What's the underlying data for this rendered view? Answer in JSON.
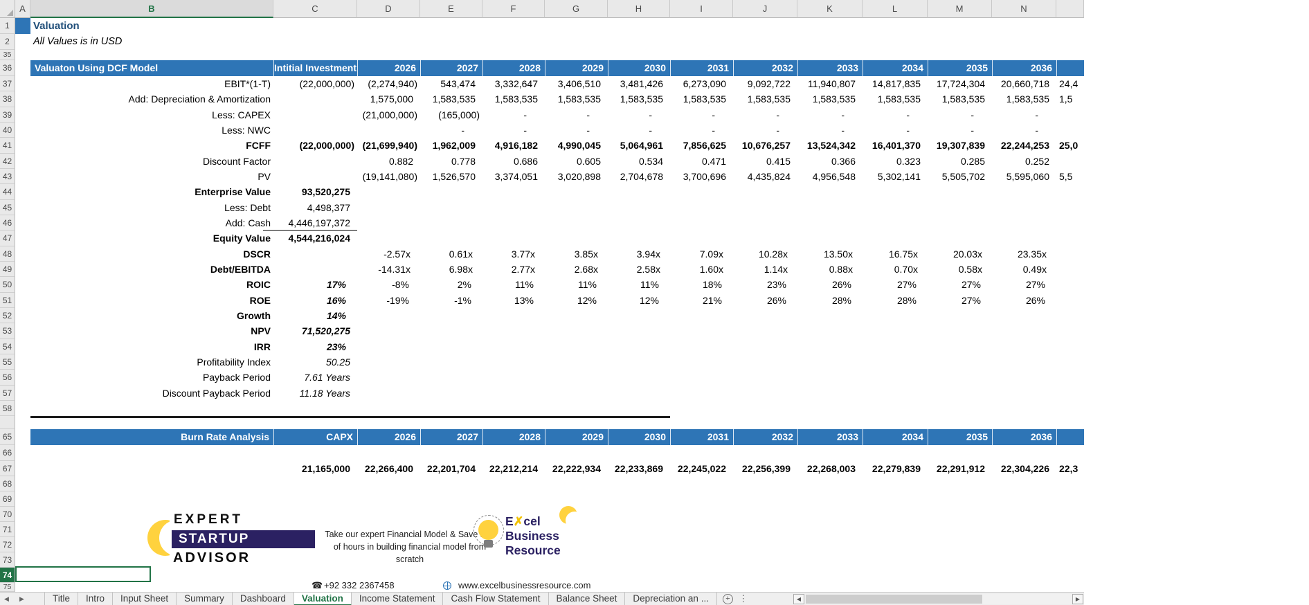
{
  "sheet": {
    "title": "Valuation",
    "subtitle": "All Values is in USD",
    "selected_column": "B",
    "active_row": "74"
  },
  "columns": [
    "A",
    "B",
    "C",
    "D",
    "E",
    "F",
    "G",
    "H",
    "I",
    "J",
    "K",
    "L",
    "M",
    "N"
  ],
  "row_numbers": [
    "1",
    "2",
    "35",
    "36",
    "37",
    "38",
    "39",
    "40",
    "41",
    "42",
    "43",
    "44",
    "45",
    "46",
    "47",
    "48",
    "49",
    "50",
    "51",
    "52",
    "53",
    "54",
    "55",
    "56",
    "57",
    "58",
    "65",
    "66",
    "67",
    "68",
    "69",
    "70",
    "71",
    "72",
    "73",
    "74",
    "75"
  ],
  "dcf": {
    "title": "Valuaton Using DCF Model",
    "investment_header": "Intitial Investment",
    "years": [
      "2026",
      "2027",
      "2028",
      "2029",
      "2030",
      "2031",
      "2032",
      "2033",
      "2034",
      "2035",
      "2036"
    ],
    "rows": [
      {
        "label": "EBIT*(1-T)",
        "c": "(22,000,000)",
        "values": [
          "(2,274,940)",
          "543,474",
          "3,332,647",
          "3,406,510",
          "3,481,426",
          "6,273,090",
          "9,092,722",
          "11,940,807",
          "14,817,835",
          "17,724,304",
          "20,660,718"
        ],
        "o": "24,4"
      },
      {
        "label": "Add: Depreciation & Amortization",
        "c": "",
        "values": [
          "1,575,000",
          "1,583,535",
          "1,583,535",
          "1,583,535",
          "1,583,535",
          "1,583,535",
          "1,583,535",
          "1,583,535",
          "1,583,535",
          "1,583,535",
          "1,583,535"
        ],
        "o": "1,5"
      },
      {
        "label": "Less: CAPEX",
        "c": "",
        "values": [
          "(21,000,000)",
          "(165,000)",
          "-",
          "-",
          "-",
          "-",
          "-",
          "-",
          "-",
          "-",
          "-"
        ],
        "o": ""
      },
      {
        "label": "Less: NWC",
        "c": "",
        "values": [
          "",
          "-",
          "-",
          "-",
          "-",
          "-",
          "-",
          "-",
          "-",
          "-",
          "-"
        ],
        "o": ""
      },
      {
        "label": "FCFF",
        "c": "(22,000,000)",
        "values": [
          "(21,699,940)",
          "1,962,009",
          "4,916,182",
          "4,990,045",
          "5,064,961",
          "7,856,625",
          "10,676,257",
          "13,524,342",
          "16,401,370",
          "19,307,839",
          "22,244,253"
        ],
        "o": "25,0"
      },
      {
        "label": "Discount Factor",
        "c": "",
        "values": [
          "0.882",
          "0.778",
          "0.686",
          "0.605",
          "0.534",
          "0.471",
          "0.415",
          "0.366",
          "0.323",
          "0.285",
          "0.252"
        ],
        "o": ""
      },
      {
        "label": "PV",
        "c": "",
        "values": [
          "(19,141,080)",
          "1,526,570",
          "3,374,051",
          "3,020,898",
          "2,704,678",
          "3,700,696",
          "4,435,824",
          "4,956,548",
          "5,302,141",
          "5,505,702",
          "5,595,060"
        ],
        "o": "5,5"
      },
      {
        "label": "Enterprise Value",
        "c": "93,520,275",
        "values": [],
        "o": ""
      },
      {
        "label": "Less: Debt",
        "c": "4,498,377",
        "values": [],
        "o": ""
      },
      {
        "label": "Add: Cash",
        "c": "4,446,197,372",
        "values": [],
        "o": ""
      },
      {
        "label": "Equity Value",
        "c": "4,544,216,024",
        "values": [],
        "o": ""
      },
      {
        "label": "DSCR",
        "c": "",
        "values": [
          "-2.57x",
          "0.61x",
          "3.77x",
          "3.85x",
          "3.94x",
          "7.09x",
          "10.28x",
          "13.50x",
          "16.75x",
          "20.03x",
          "23.35x"
        ],
        "o": ""
      },
      {
        "label": "Debt/EBITDA",
        "c": "",
        "values": [
          "-14.31x",
          "6.98x",
          "2.77x",
          "2.68x",
          "2.58x",
          "1.60x",
          "1.14x",
          "0.88x",
          "0.70x",
          "0.58x",
          "0.49x"
        ],
        "o": ""
      },
      {
        "label": "ROIC",
        "c": "17%",
        "values": [
          "-8%",
          "2%",
          "11%",
          "11%",
          "11%",
          "18%",
          "23%",
          "26%",
          "27%",
          "27%",
          "27%"
        ],
        "o": ""
      },
      {
        "label": "ROE",
        "c": "16%",
        "values": [
          "-19%",
          "-1%",
          "13%",
          "12%",
          "12%",
          "21%",
          "26%",
          "28%",
          "28%",
          "27%",
          "26%"
        ],
        "o": ""
      },
      {
        "label": "Growth",
        "c": "14%",
        "values": [],
        "o": ""
      },
      {
        "label": "NPV",
        "c": "71,520,275",
        "values": [],
        "o": ""
      },
      {
        "label": "IRR",
        "c": "23%",
        "values": [],
        "o": ""
      },
      {
        "label": "Profitability Index",
        "c": "50.25",
        "values": [],
        "o": ""
      },
      {
        "label": "Payback Period",
        "c": "7.61 Years",
        "values": [],
        "o": ""
      },
      {
        "label": "Discount Payback Period",
        "c": "11.18 Years",
        "values": [],
        "o": ""
      }
    ]
  },
  "burn": {
    "title": "Burn Rate Analysis",
    "capx_header": "CAPX",
    "years": [
      "2026",
      "2027",
      "2028",
      "2029",
      "2030",
      "2031",
      "2032",
      "2033",
      "2034",
      "2035",
      "2036"
    ],
    "capx_value": "21,165,000",
    "values": [
      "22,266,400",
      "22,201,704",
      "22,212,214",
      "22,222,934",
      "22,233,869",
      "22,245,022",
      "22,256,399",
      "22,268,003",
      "22,279,839",
      "22,291,912",
      "22,304,226"
    ],
    "o": "22,3"
  },
  "branding": {
    "esa": {
      "line1": "EXPERT",
      "line2": "STARTUP",
      "line3": "ADVISOR"
    },
    "tagline_lines": [
      "Take our expert Financial Model & Save 100",
      "of hours in building financial model from",
      "scratch"
    ],
    "ebr": {
      "excel_e": "E",
      "excel_x": "✗",
      "excel_cel": "cel",
      "line2": "Business",
      "line3": "Resource"
    }
  },
  "contact": {
    "phone": "+92 332 2367458",
    "website": "www.excelbusinessresource.com"
  },
  "tabs": {
    "items": [
      "Title",
      "Intro",
      "Input Sheet",
      "Summary",
      "Dashboard",
      "Valuation",
      "Income Statement",
      "Cash Flow Statement",
      "Balance Sheet",
      "Depreciation an"
    ],
    "active": "Valuation",
    "overflow_ellipsis": " ..."
  },
  "icons": {
    "phone": "☎",
    "new_sheet": "+",
    "more": "⋮",
    "tab_nav_left": "◀",
    "tab_nav_right": "▶",
    "scroll_left": "◀",
    "scroll_right": "▶"
  },
  "colors": {
    "header_band": "#2E75B6",
    "excel_green": "#217346",
    "brand_navy": "#2B2162",
    "brand_yellow": "#FFD23E",
    "title_blue": "#1F4E79"
  }
}
